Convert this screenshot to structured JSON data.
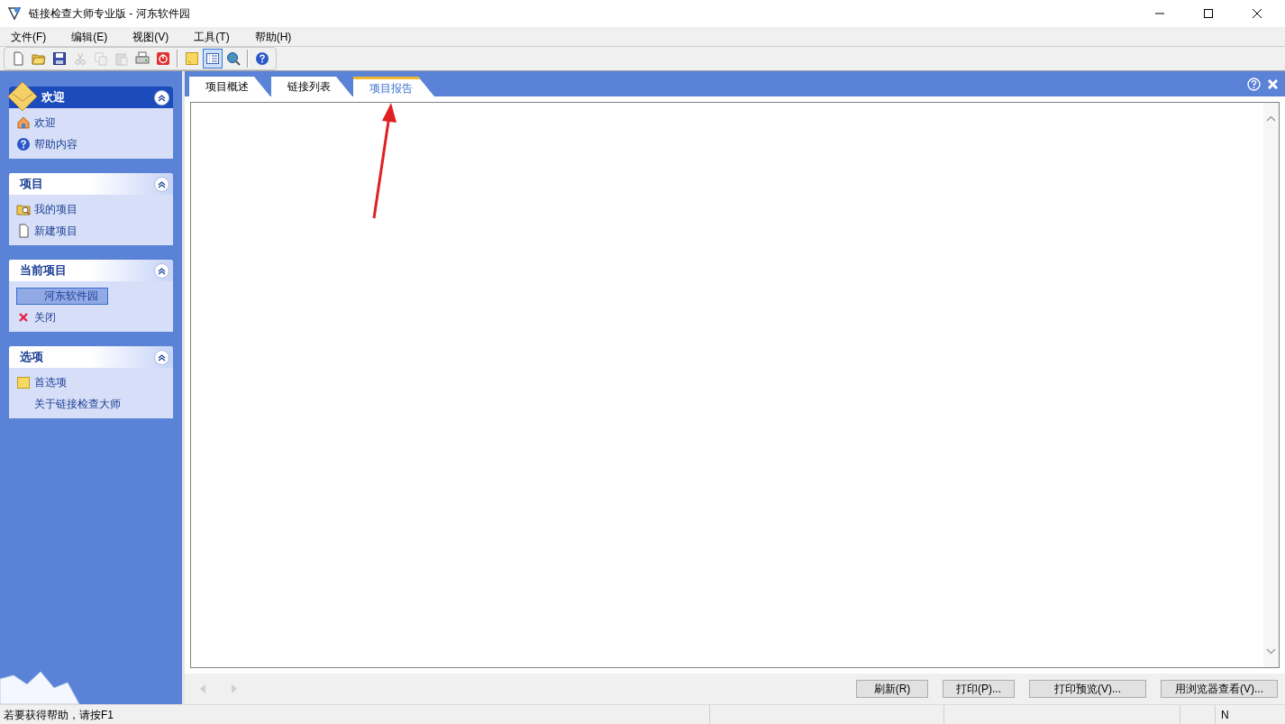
{
  "window": {
    "title": "链接检查大师专业版 - 河东软件园"
  },
  "menu": [
    "文件(F)",
    "编辑(E)",
    "视图(V)",
    "工具(T)",
    "帮助(H)"
  ],
  "toolbar": [
    {
      "kind": "new",
      "disabled": false,
      "pressed": false
    },
    {
      "kind": "open",
      "disabled": false,
      "pressed": false
    },
    {
      "kind": "save",
      "disabled": false,
      "pressed": false
    },
    {
      "kind": "cut",
      "disabled": true,
      "pressed": false
    },
    {
      "kind": "copy",
      "disabled": true,
      "pressed": false
    },
    {
      "kind": "paste",
      "disabled": true,
      "pressed": false
    },
    {
      "kind": "print",
      "disabled": false,
      "pressed": false
    },
    {
      "kind": "stop",
      "disabled": false,
      "pressed": false
    },
    {
      "kind": "sep"
    },
    {
      "kind": "note",
      "disabled": false,
      "pressed": false
    },
    {
      "kind": "list",
      "disabled": false,
      "pressed": true
    },
    {
      "kind": "globe",
      "disabled": false,
      "pressed": false
    },
    {
      "kind": "sep"
    },
    {
      "kind": "help",
      "disabled": false,
      "pressed": false
    }
  ],
  "sidebar": {
    "panels": [
      {
        "title": "欢迎",
        "kind": "primary",
        "expanded": true,
        "items": [
          {
            "label": "欢迎",
            "selected": false
          },
          {
            "label": "帮助内容",
            "selected": false
          }
        ]
      },
      {
        "title": "项目",
        "kind": "normal",
        "expanded": true,
        "items": [
          {
            "label": "我的项目",
            "selected": false
          },
          {
            "label": "新建项目",
            "selected": false
          }
        ]
      },
      {
        "title": "当前项目",
        "kind": "normal",
        "expanded": true,
        "items": [
          {
            "label": "河东软件园",
            "selected": true
          },
          {
            "label": "关闭",
            "selected": false
          }
        ]
      },
      {
        "title": "选项",
        "kind": "normal",
        "expanded": true,
        "items": [
          {
            "label": "首选项",
            "selected": false
          },
          {
            "label": "关于链接检查大师",
            "selected": false
          }
        ]
      }
    ]
  },
  "tabs": [
    {
      "label": "项目概述",
      "selected": false
    },
    {
      "label": "链接列表",
      "selected": false
    },
    {
      "label": "项目报告",
      "selected": true
    }
  ],
  "buttons": [
    "刷新(R)",
    "打印(P)...",
    "打印预览(V)...",
    "用浏览器查看(V)..."
  ],
  "status_bar": {
    "message": "若要获得帮助，请按F1",
    "indicator": "N"
  }
}
